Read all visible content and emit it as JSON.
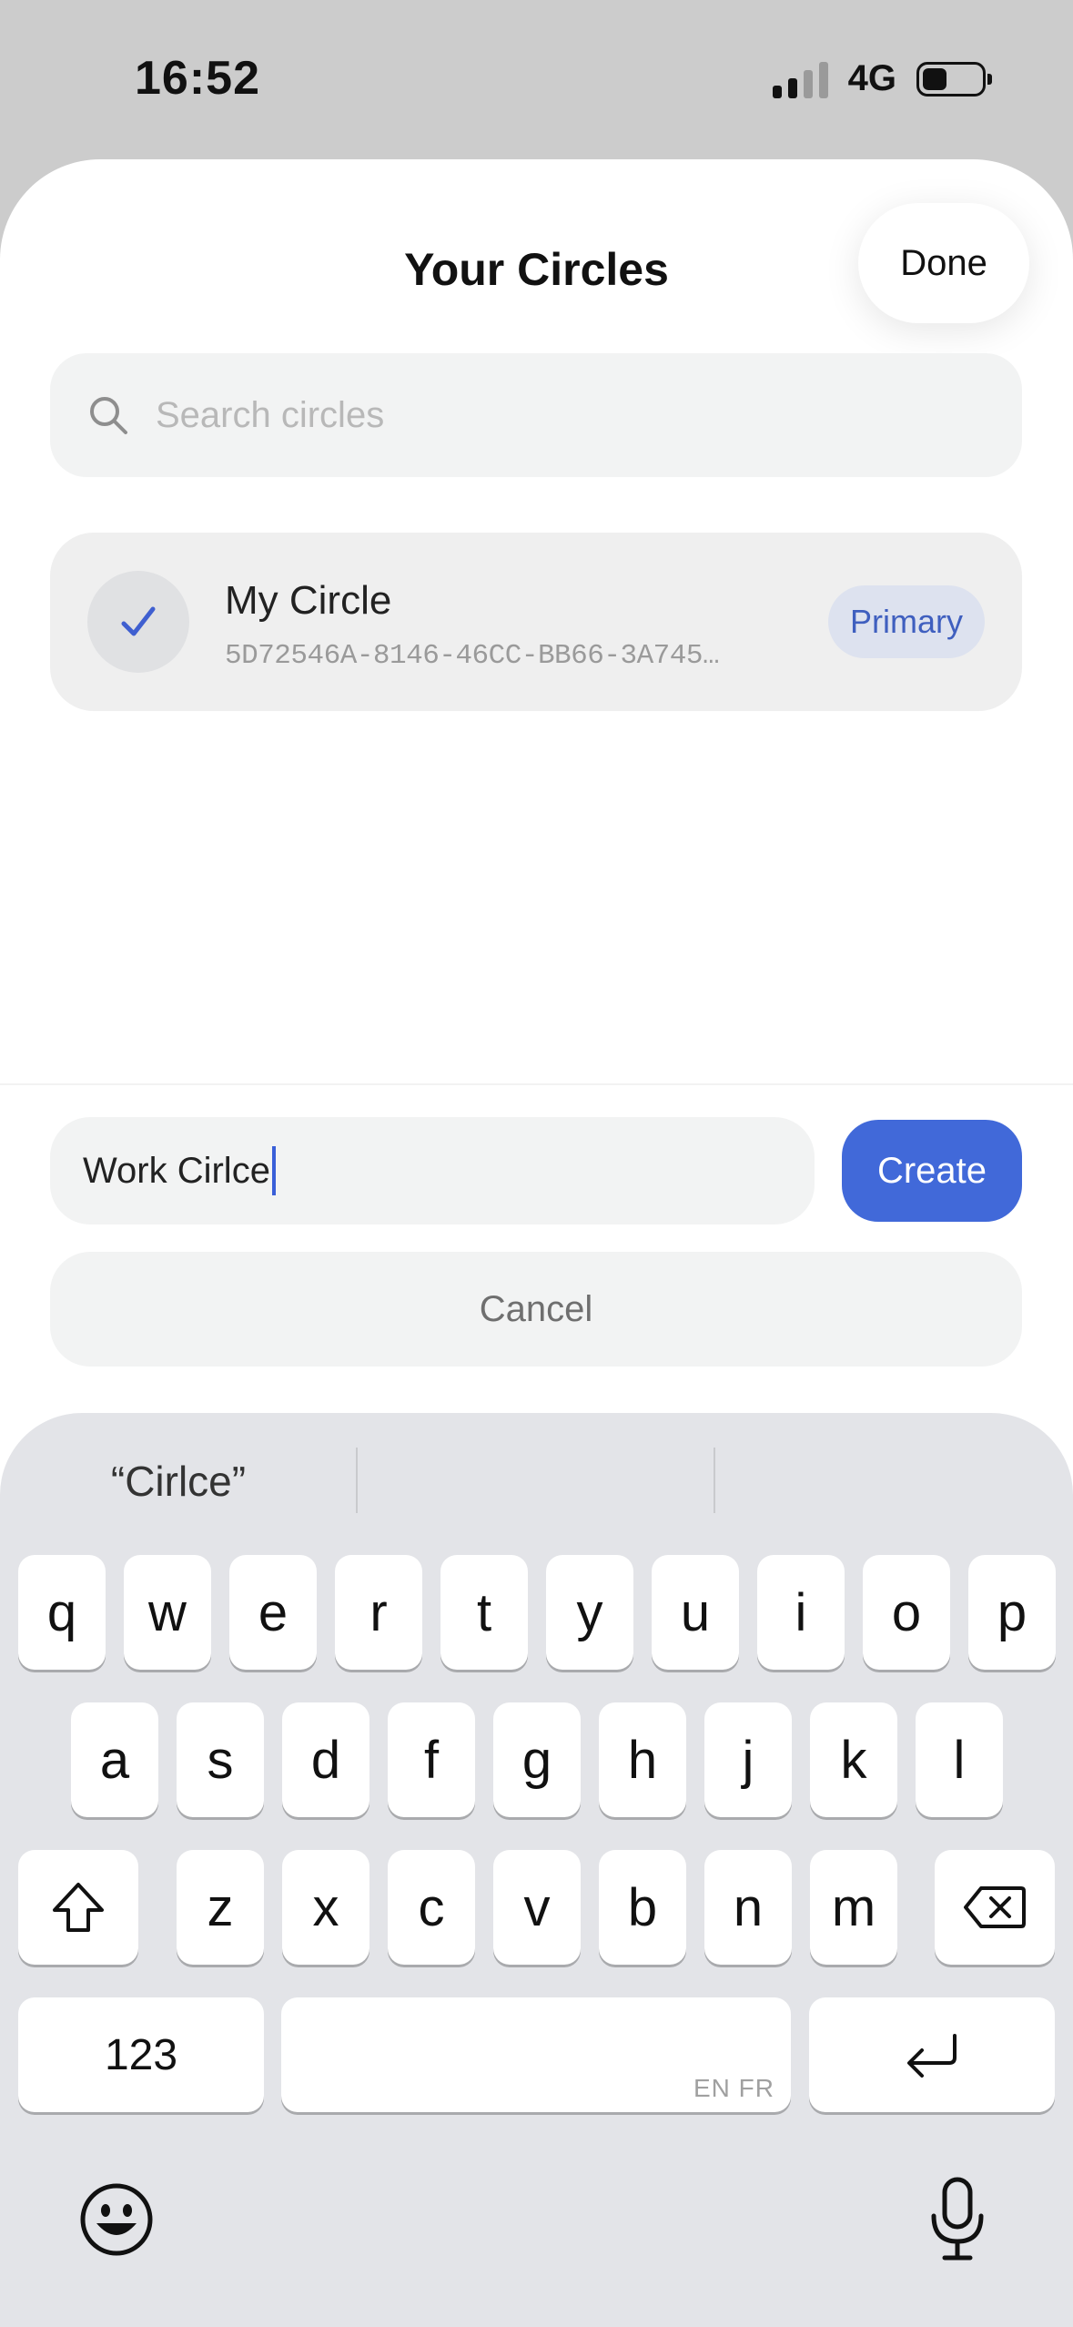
{
  "status_bar": {
    "time": "16:52",
    "network": "4G",
    "battery_level": 0.42
  },
  "sheet": {
    "title": "Your Circles",
    "done_label": "Done",
    "search": {
      "placeholder": "Search circles"
    },
    "circles": [
      {
        "name": "My Circle",
        "id": "5D72546A-8146-46CC-BB66-3A745…",
        "badge": "Primary",
        "selected": true
      }
    ],
    "new_circle": {
      "value": "Work Cirlce",
      "create_label": "Create",
      "cancel_label": "Cancel"
    }
  },
  "keyboard": {
    "suggestions": [
      "“Cirlce”",
      "",
      ""
    ],
    "row1": [
      "q",
      "w",
      "e",
      "r",
      "t",
      "y",
      "u",
      "i",
      "o",
      "p"
    ],
    "row2": [
      "a",
      "s",
      "d",
      "f",
      "g",
      "h",
      "j",
      "k",
      "l"
    ],
    "row3": [
      "z",
      "x",
      "c",
      "v",
      "b",
      "n",
      "m"
    ],
    "numbers_label": "123",
    "space_hint": "EN FR",
    "icons": [
      "shift-icon",
      "delete-icon",
      "return-icon",
      "emoji-icon",
      "microphone-icon"
    ]
  },
  "colors": {
    "accent": "#4169d9",
    "badge_text": "#3f5fbf",
    "badge_bg": "#dde2ef"
  }
}
